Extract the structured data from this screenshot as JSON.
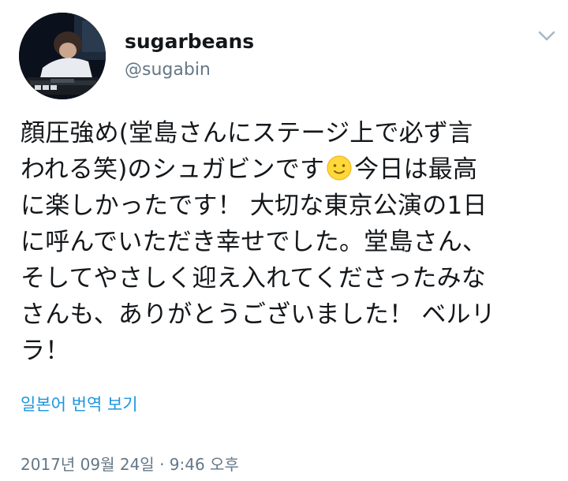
{
  "user": {
    "name": "sugarbeans",
    "handle": "@sugabin"
  },
  "tweet": {
    "lines": {
      "l1": "顔圧強め(堂島さんにステージ上で必ず言",
      "l2a": "われる笑)のシュガビンです",
      "l2b": "今日は最高",
      "l3": "に楽しかったです！ 大切な東京公演の1日",
      "l4": "に呼んでいただき幸せでした。堂島さん、",
      "l5": "そしてやさしく迎え入れてくださったみな",
      "l6": "さんも、ありがとうございました！ ベルリ",
      "l7": "ラ！"
    },
    "emoji": "smiling-sun-face-emoji"
  },
  "translate_label": "일본어 번역 보기",
  "timestamp": "2017년 09월 24일 · 9:46 오후",
  "colors": {
    "text": "#14171a",
    "secondary": "#657786",
    "link": "#1b95e0",
    "chevron": "#aab8c2"
  }
}
